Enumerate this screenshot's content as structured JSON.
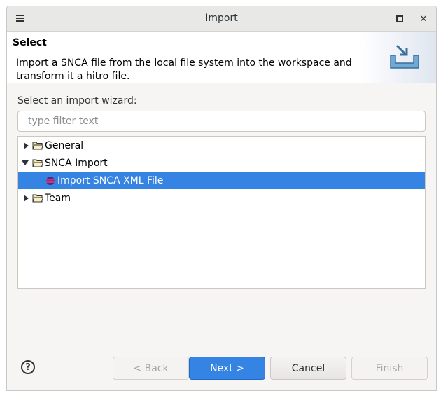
{
  "window": {
    "title": "Import"
  },
  "banner": {
    "title": "Select",
    "description": "Import a SNCA file from the local file system into the workspace and transform it a hitro file."
  },
  "wizard": {
    "prompt": "Select an import wizard:",
    "filter_placeholder": "type filter text",
    "filter_value": ""
  },
  "tree": {
    "items": [
      {
        "label": "General",
        "expanded": false,
        "level": 0,
        "icon": "folder-icon"
      },
      {
        "label": "SNCA Import",
        "expanded": true,
        "level": 0,
        "icon": "folder-open-icon"
      },
      {
        "label": "Import SNCA XML File",
        "level": 1,
        "selected": true,
        "icon": "xml-file-icon"
      },
      {
        "label": "Team",
        "expanded": false,
        "level": 0,
        "icon": "folder-icon"
      }
    ]
  },
  "buttons": {
    "help": "?",
    "back": "< Back",
    "next": "Next >",
    "cancel": "Cancel",
    "finish": "Finish"
  },
  "colors": {
    "accent": "#3584e4",
    "selection_text": "#ffffff",
    "window_bg": "#f6f5f4",
    "titlebar_bg": "#e8e8e7"
  }
}
